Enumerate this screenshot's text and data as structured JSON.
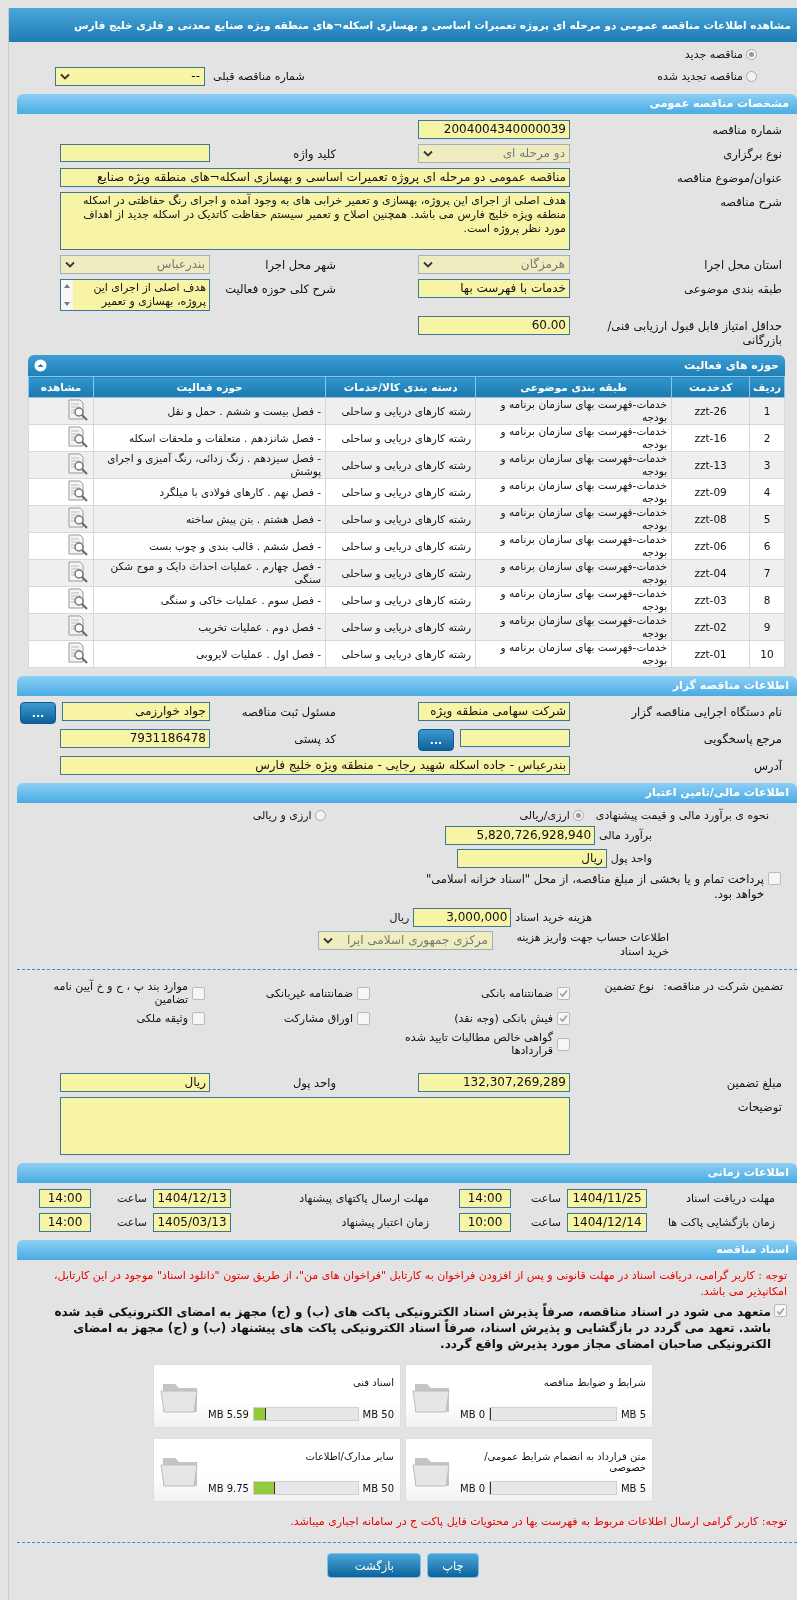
{
  "title": "مشاهده اطلاعات مناقصه عمومی دو مرحله ای پروژه تعمیرات اساسی و بهسازی اسکله¬های منطقه ویژه صنایع معدنی و فلزی خلیج فارس",
  "tender_type": [
    {
      "label": "مناقصه جدید",
      "selected": true
    },
    {
      "label": "مناقصه تجدید شده",
      "selected": false
    }
  ],
  "previous_tender": {
    "label": "شماره مناقصه قبلی",
    "value": "--",
    "kind": "select",
    "disabled": false
  },
  "general": {
    "heading": "مشخصات مناقصه عمومی",
    "rows": [
      [
        {
          "label": "شماره مناقصه",
          "value": "2004004340000039",
          "kind": "text"
        }
      ],
      [
        {
          "label": "نوع برگزاری",
          "value": "دو مرحله ای",
          "kind": "select",
          "disabled": true
        },
        {
          "label": "کلید واژه",
          "kind": "text"
        }
      ],
      [
        {
          "label": "عنوان/موضوع مناقصه",
          "value": "مناقصه عمومی دو مرحله ای پروژه تعمیرات اساسی و بهسازی اسکله¬های منطقه ویژه صنایع",
          "kind": "wide_text"
        }
      ],
      [
        {
          "label": "شرح مناقصه",
          "value": "هدف اصلی از اجرای این پروژه، بهسازی و تعمیر خرابی های به وجود آمده و اجرای رنگ حفاظتی در اسکله منطقه ویژه خلیج فارس می باشد. همچنین اصلاح و تعمیر سیستم حفاظت کاتدیک در اسکله جدید از اهداف مورد نظر پروژه است.",
          "kind": "textarea"
        }
      ],
      [
        {
          "label": "استان محل اجرا",
          "value": "هرمزگان",
          "kind": "select",
          "disabled": true
        },
        {
          "label": "شهر محل اجرا",
          "value": "بندرعباس",
          "kind": "select",
          "disabled": true
        }
      ],
      [
        {
          "label": "طبقه بندی موضوعی",
          "value": "خدمات با فهرست بها",
          "kind": "text"
        },
        {
          "label": "شرح کلی حوزه فعالیت",
          "value": "هدف اصلی از اجرای این پروژه، بهسازی و تعمیر",
          "kind": "scroll"
        }
      ],
      [
        {
          "label": "حداقل امتیاز قابل قبول ارزیابی فنی/بازرگانی",
          "value": "60.00",
          "kind": "text"
        }
      ]
    ]
  },
  "activities": {
    "heading": "حوزه های فعالیت",
    "columns": [
      "ردیف",
      "کدخدمت",
      "طبقه بندی موضوعی",
      "دسته بندی کالا/خدمات",
      "حوزه فعالیت",
      "مشاهده"
    ],
    "rows": [
      [
        "1",
        "zzt-26",
        "خدمات-فهرست بهای سازمان برنامه و بودجه",
        "رشته کارهای دریایی و ساحلی",
        "- فصل بیست و ششم . حمل و نقل"
      ],
      [
        "2",
        "zzt-16",
        "خدمات-فهرست بهای سازمان برنامه و بودجه",
        "رشته کارهای دریایی و ساحلی",
        "- فصل شانزدهم . متعلقات و ملحقات اسکله"
      ],
      [
        "3",
        "zzt-13",
        "خدمات-فهرست بهای سازمان برنامه و بودجه",
        "رشته کارهای دریایی و ساحلی",
        "- فصل سیزدهم . زنگ زدائی، رنگ آمیزی و اجرای پوشش"
      ],
      [
        "4",
        "zzt-09",
        "خدمات-فهرست بهای سازمان برنامه و بودجه",
        "رشته کارهای دریایی و ساحلی",
        "- فصل نهم . کارهای فولادی با میلگرد"
      ],
      [
        "5",
        "zzt-08",
        "خدمات-فهرست بهای سازمان برنامه و بودجه",
        "رشته کارهای دریایی و ساحلی",
        "- فصل هشتم . بتن پیش ساخته"
      ],
      [
        "6",
        "zzt-06",
        "خدمات-فهرست بهای سازمان برنامه و بودجه",
        "رشته کارهای دریایی و ساحلی",
        "- فصل ششم . قالب بندی و چوب بست"
      ],
      [
        "7",
        "zzt-04",
        "خدمات-فهرست بهای سازمان برنامه و بودجه",
        "رشته کارهای دریایی و ساحلی",
        "- فصل چهارم . عملیات احداث دایک و موج شکن سنگی"
      ],
      [
        "8",
        "zzt-03",
        "خدمات-فهرست بهای سازمان برنامه و بودجه",
        "رشته کارهای دریایی و ساحلی",
        "- فصل سوم . عملیات خاکی و سنگی"
      ],
      [
        "9",
        "zzt-02",
        "خدمات-فهرست بهای سازمان برنامه و بودجه",
        "رشته کارهای دریایی و ساحلی",
        "- فصل دوم . عملیات تخریب"
      ],
      [
        "10",
        "zzt-01",
        "خدمات-فهرست بهای سازمان برنامه و بودجه",
        "رشته کارهای دریایی و ساحلی",
        "- فصل اول . عملیات لایروبی"
      ]
    ]
  },
  "organizer": {
    "heading": "اطلاعات مناقصه گزار",
    "rows": [
      [
        {
          "label": "نام دستگاه اجرایی مناقصه گزار",
          "value": "شرکت سهامی منطقه ویژه",
          "kind": "text"
        },
        {
          "label": "مسئول ثبت مناقصه",
          "value": "جواد خوارزمی",
          "kind": "text",
          "button": "..."
        }
      ],
      [
        {
          "label": "مرجع پاسخگویی",
          "kind": "text",
          "button": "..."
        },
        {
          "label": "کد پستی",
          "value": "7931186478",
          "kind": "text"
        }
      ],
      [
        {
          "label": "آدرس",
          "value": "بندرعباس - جاده اسکله شهید رجایی - منطقه ویژه خلیج فارس",
          "kind": "wide_text"
        }
      ]
    ]
  },
  "finance": {
    "heading": "اطلاعات مالی/تامین اعتبار",
    "estimate_label": "نحوه ی برآورد مالی و قیمت پیشنهادی",
    "estimate_options": [
      {
        "label": "ارزی/ریالی",
        "selected": true
      },
      {
        "label": "ارزی و ریالی",
        "selected": false
      }
    ],
    "fields": [
      {
        "label": "برآورد مالی",
        "value": "5,820,726,928,940"
      },
      {
        "label": "واحد پول",
        "value": "ریال"
      }
    ],
    "treasury": {
      "label": "پرداخت تمام و یا بخشی از مبلغ مناقصه، از محل \"اسناد خزانه اسلامی\" خواهد بود.",
      "checked": false
    },
    "doc_fee": {
      "label": "هزینه خرید اسناد",
      "value": "3,000,000",
      "unit": "ریال"
    },
    "account": {
      "label": "اطلاعات حساب جهت واریز هزینه خرید اسناد",
      "value": "مرکزی جمهوری اسلامی ایرا",
      "kind": "select",
      "disabled": true
    }
  },
  "guarantee": {
    "label": "تضمین شرکت در مناقصه:",
    "type_label": "نوع تضمین",
    "options": [
      {
        "label": "ضمانتنامه بانکی",
        "checked": true
      },
      {
        "label": "ضمانتنامه غیربانکی",
        "checked": false
      },
      {
        "label": "موارد بند پ ، ح و خ آیین نامه تضامین",
        "checked": false
      },
      {
        "label": "فیش بانکی (وجه نقد)",
        "checked": true
      },
      {
        "label": "اوراق مشارکت",
        "checked": false
      },
      {
        "label": "وثیقه ملکی",
        "checked": false
      },
      {
        "label": "گواهی خالص مطالبات تایید شده قراردادها",
        "checked": false
      }
    ],
    "rows": [
      [
        {
          "label": "مبلغ تضمین",
          "value": "132,307,269,289",
          "kind": "text"
        },
        {
          "label": "واحد پول",
          "value": "ریال",
          "kind": "text"
        }
      ],
      [
        {
          "label": "توضیحات",
          "kind": "textarea"
        }
      ]
    ]
  },
  "timing": {
    "heading": "اطلاعات زمانی",
    "rows": [
      [
        {
          "label": "مهلت دریافت اسناد",
          "date": "1404/11/25",
          "time_label": "ساعت",
          "time": "14:00"
        },
        {
          "label": "مهلت ارسال پاکتهای پیشنهاد",
          "date": "1404/12/13",
          "time_label": "ساعت",
          "time": "14:00"
        }
      ],
      [
        {
          "label": "زمان بازگشایی پاکت ها",
          "date": "1404/12/14",
          "time_label": "ساعت",
          "time": "10:00"
        },
        {
          "label": "زمان اعتبار پیشنهاد",
          "date": "1405/03/13",
          "time_label": "ساعت",
          "time": "14:00"
        }
      ]
    ]
  },
  "documents": {
    "heading": "اسناد مناقصه",
    "notice": "توجه : کاربر گرامی، دریافت اسناد در مهلت قانونی و پس از افزودن فراخوان به کارتابل \"فراخوان های من\"، از طریق ستون \"دانلود اسناد\" موجود در این کارتابل، امکانپذیر می باشد.",
    "commitment": {
      "text": "متعهد می شود در اسناد مناقصه، صرفاً پذیرش اسناد الکترونیکی پاکت های (ب) و (ج) مجهز به امضای الکترونیکی قید شده باشد. تعهد می گردد در بازگشایی و پذیرش اسناد، صرفاً اسناد الکترونیکی پاکت های پیشنهاد (ب) و (ج) مجهز به امضای الکترونیکی صاحبان امضای مجاز مورد پذیرش واقع گردد.",
      "checked": true
    },
    "files": [
      {
        "title": "شرایط و ضوابط مناقصه",
        "used": "0 MB",
        "max": "5 MB",
        "level": 0
      },
      {
        "title": "اسناد فنی",
        "used": "5.59 MB",
        "max": "50 MB",
        "level": 0.11
      },
      {
        "title": "متن قرارداد به انضمام شرایط عمومی/خصوصی",
        "used": "0 MB",
        "max": "5 MB",
        "level": 0
      },
      {
        "title": "سایر مدارک/اطلاعات",
        "used": "9.75 MB",
        "max": "50 MB",
        "level": 0.195
      }
    ],
    "footer_notice": "توجه: کاربر گرامی ارسال اطلاعات مربوط به فهرست بها در محتویات فایل پاکت ج در سامانه اجباری میباشد."
  },
  "buttons": [
    "چاپ",
    "بازگشت"
  ]
}
